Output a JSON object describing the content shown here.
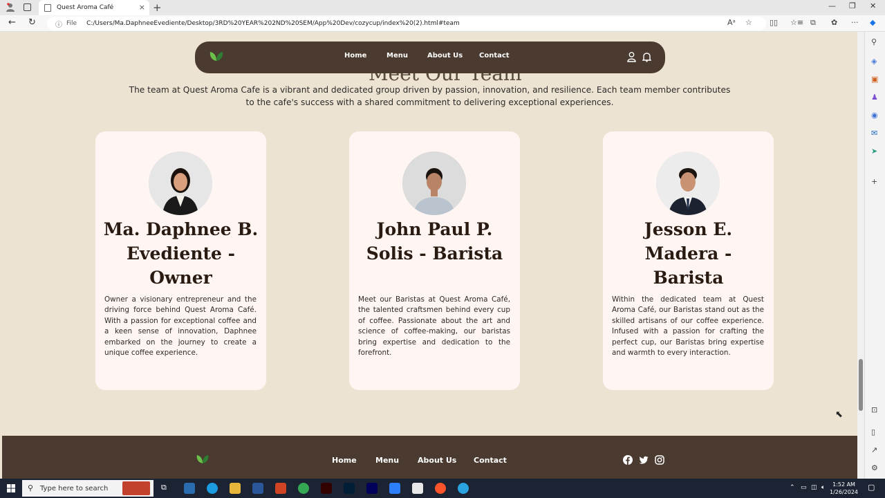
{
  "browser": {
    "tab_title": "Quest Aroma Café",
    "tab_close": "×",
    "new_tab": "+",
    "url_prefix": "File",
    "url": "C:/Users/Ma.DaphneeEvediente/Desktop/3RD%20YEAR%202ND%20SEM/App%20Dev/cozycup/index%20(2).html#team",
    "window_controls": [
      "—",
      "❐",
      "✕"
    ]
  },
  "navbar": {
    "links": [
      "Home",
      "Menu",
      "About Us",
      "Contact"
    ]
  },
  "section": {
    "heading_partial": "Meet Our Team",
    "intro": "The team at Quest Aroma Cafe is a vibrant and dedicated group driven by passion, innovation, and resilience. Each team member contributes to the cafe's success with a shared commitment to delivering exceptional experiences."
  },
  "team": [
    {
      "name": "Ma. Daphnee B. Evediente - Owner",
      "description": "Owner a visionary entrepreneur and the driving force behind Quest Aroma Café. With a passion for exceptional coffee and a keen sense of innovation, Daphnee embarked on the journey to create a unique coffee experience."
    },
    {
      "name": "John Paul P. Solis - Barista",
      "description": "Meet our Baristas at Quest Aroma Café, the talented craftsmen behind every cup of coffee. Passionate about the art and science of coffee-making, our baristas bring expertise and dedication to the forefront."
    },
    {
      "name": "Jesson E. Madera - Barista",
      "description": "Within the dedicated team at Quest Aroma Café, our Baristas stand out as the skilled artisans of our coffee experience. Infused with a passion for crafting the perfect cup, our Baristas bring expertise and warmth to every interaction."
    }
  ],
  "footer": {
    "links": [
      "Home",
      "Menu",
      "About Us",
      "Contact"
    ],
    "social_icons": [
      "facebook-icon",
      "twitter-icon",
      "instagram-icon"
    ]
  },
  "taskbar": {
    "search_placeholder": "Type here to search",
    "time": "1:52 AM",
    "date": "1/26/2024"
  },
  "colors": {
    "page_bg": "#ece3d3",
    "nav_bg": "#4a3a2f",
    "card_bg": "#fff6f3",
    "name_color": "#2a1b12"
  }
}
